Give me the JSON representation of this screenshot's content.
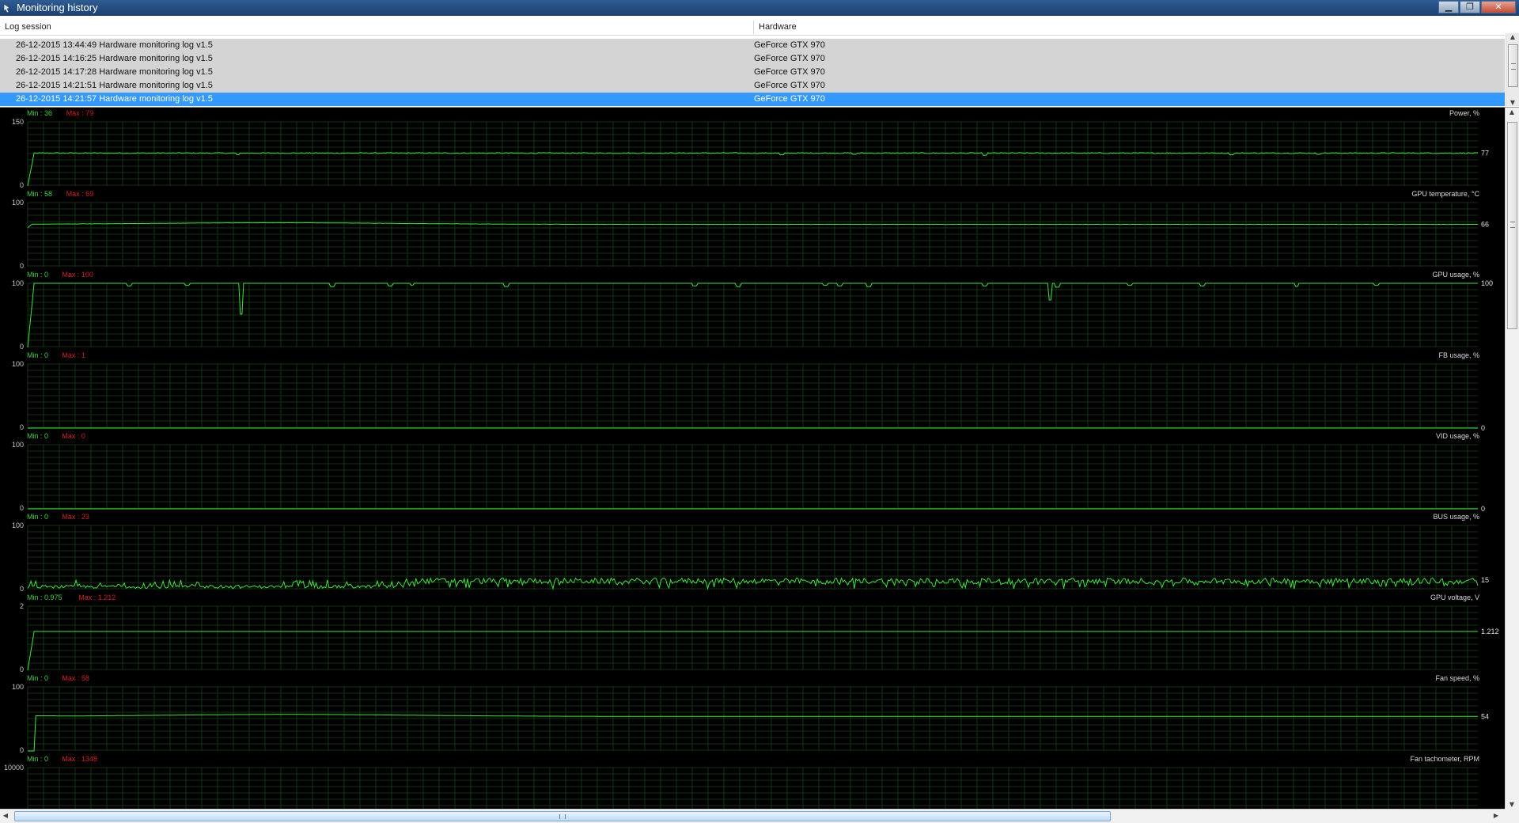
{
  "window": {
    "title": "Monitoring history",
    "buttons": {
      "minimize": "▁",
      "maximize": "❐",
      "close": "✕"
    }
  },
  "list": {
    "columns": [
      "Log session",
      "Hardware"
    ],
    "rows": [
      {
        "session": "26-12-2015 13:44:49 Hardware monitoring log v1.5",
        "hardware": "GeForce GTX 970",
        "selected": false
      },
      {
        "session": "26-12-2015 14:16:25 Hardware monitoring log v1.5",
        "hardware": "GeForce GTX 970",
        "selected": false
      },
      {
        "session": "26-12-2015 14:17:28 Hardware monitoring log v1.5",
        "hardware": "GeForce GTX 970",
        "selected": false
      },
      {
        "session": "26-12-2015 14:21:51 Hardware monitoring log v1.5",
        "hardware": "GeForce GTX 970",
        "selected": false
      },
      {
        "session": "26-12-2015 14:21:57 Hardware monitoring log v1.5",
        "hardware": "GeForce GTX 970",
        "selected": true
      }
    ]
  },
  "colors": {
    "trace": "#3ce63c",
    "grid": "#123412",
    "axis_text": "#c8c8c8",
    "min_text": "#3ad23a",
    "max_text": "#d02020",
    "selection": "#3399ff"
  },
  "chart_data": [
    {
      "type": "line",
      "title": "Power, %",
      "min_label": "Min : 36",
      "max_label": "Max : 79",
      "ymax_label": "150",
      "ymin_label": "0",
      "ylim": [
        0,
        150
      ],
      "current": "77",
      "shape": "steady",
      "level": 77,
      "noise": 1.2,
      "dips": [
        [
          0.145,
          4
        ],
        [
          0.52,
          4
        ],
        [
          0.57,
          3
        ],
        [
          0.66,
          5
        ],
        [
          0.83,
          4
        ],
        [
          0.89,
          3
        ]
      ]
    },
    {
      "type": "line",
      "title": "GPU temperature, °C",
      "min_label": "Min : 58",
      "max_label": "Max : 69",
      "ymax_label": "100",
      "ymin_label": "0",
      "ylim": [
        0,
        100
      ],
      "current": "66",
      "shape": "temp",
      "level": 66,
      "noise": 0.3,
      "dips": []
    },
    {
      "type": "line",
      "title": "GPU usage, %",
      "min_label": "Min : 0",
      "max_label": "Max : 100",
      "ymax_label": "100",
      "ymin_label": "0",
      "ylim": [
        0,
        100
      ],
      "current": "100",
      "shape": "steady",
      "level": 100,
      "noise": 0,
      "dips": [
        [
          0.07,
          4
        ],
        [
          0.11,
          3
        ],
        [
          0.147,
          48
        ],
        [
          0.21,
          5
        ],
        [
          0.25,
          4
        ],
        [
          0.265,
          3
        ],
        [
          0.33,
          5
        ],
        [
          0.46,
          4
        ],
        [
          0.49,
          5
        ],
        [
          0.55,
          3
        ],
        [
          0.56,
          4
        ],
        [
          0.58,
          5
        ],
        [
          0.66,
          4
        ],
        [
          0.705,
          26
        ],
        [
          0.71,
          6
        ],
        [
          0.76,
          3
        ],
        [
          0.81,
          4
        ],
        [
          0.875,
          5
        ],
        [
          0.93,
          3
        ]
      ]
    },
    {
      "type": "line",
      "title": "FB usage, %",
      "min_label": "Min : 0",
      "max_label": "Max : 1",
      "ymax_label": "100",
      "ymin_label": "0",
      "ylim": [
        0,
        100
      ],
      "current": "0",
      "shape": "flat",
      "level": 0,
      "noise": 0,
      "dips": []
    },
    {
      "type": "line",
      "title": "VID usage, %",
      "min_label": "Min : 0",
      "max_label": "Max : 0",
      "ymax_label": "100",
      "ymin_label": "0",
      "ylim": [
        0,
        100
      ],
      "current": "0",
      "shape": "flat",
      "level": 0,
      "noise": 0,
      "dips": []
    },
    {
      "type": "line",
      "title": "BUS usage, %",
      "min_label": "Min : 0",
      "max_label": "Max : 23",
      "ymax_label": "100",
      "ymin_label": "0",
      "ylim": [
        0,
        100
      ],
      "current": "15",
      "shape": "bus",
      "level": 15,
      "noise": 6,
      "dips": []
    },
    {
      "type": "line",
      "title": "GPU voltage, V",
      "min_label": "Min : 0.975",
      "max_label": "Max : 1.212",
      "ymax_label": "2",
      "ymin_label": "0",
      "ylim": [
        0,
        2
      ],
      "current": "1.212",
      "shape": "steady",
      "level": 1.212,
      "noise": 0,
      "dips": []
    },
    {
      "type": "line",
      "title": "Fan speed, %",
      "min_label": "Min : 0",
      "max_label": "Max : 58",
      "ymax_label": "100",
      "ymin_label": "0",
      "ylim": [
        0,
        100
      ],
      "current": "54",
      "shape": "fan",
      "level": 54,
      "noise": 0,
      "dips": []
    },
    {
      "type": "line",
      "title": "Fan tachometer, RPM",
      "min_label": "Min : 0",
      "max_label": "Max : 1348",
      "ymax_label": "10000",
      "ymin_label": "",
      "ylim": [
        0,
        10000
      ],
      "current": "",
      "shape": "none",
      "level": 0,
      "noise": 0,
      "dips": []
    }
  ]
}
